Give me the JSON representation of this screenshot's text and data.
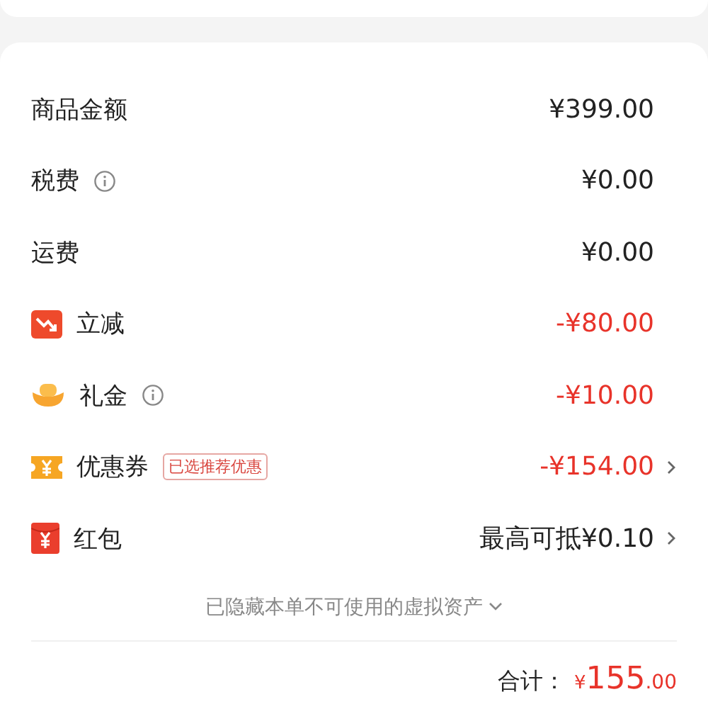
{
  "rows": [
    {
      "kind": "plain",
      "label": "商品金额",
      "info": false,
      "amount": "¥399.00",
      "discount": false,
      "chevron": false
    },
    {
      "kind": "plain",
      "label": "税费",
      "info": true,
      "amount": "¥0.00",
      "discount": false,
      "chevron": false
    },
    {
      "kind": "plain",
      "label": "运费",
      "info": false,
      "amount": "¥0.00",
      "discount": false,
      "chevron": false
    },
    {
      "kind": "drop",
      "label": "立减",
      "info": false,
      "amount": "-¥80.00",
      "discount": true,
      "chevron": false
    },
    {
      "kind": "ingot",
      "label": "礼金",
      "info": true,
      "amount": "-¥10.00",
      "discount": true,
      "chevron": false
    },
    {
      "kind": "coupon",
      "label": "优惠券",
      "info": false,
      "tag": "已选推荐优惠",
      "amount": "-¥154.00",
      "discount": true,
      "chevron": true
    },
    {
      "kind": "packet",
      "label": "红包",
      "info": false,
      "amount": "最高可抵¥0.10",
      "discount": false,
      "chevron": true
    }
  ],
  "hidden_note": {
    "text": "已隐藏本单不可使用的虚拟资产",
    "expanded": false
  },
  "total": {
    "label": "合计：",
    "currency": "¥",
    "integer": "155",
    "decimal": ".00"
  }
}
